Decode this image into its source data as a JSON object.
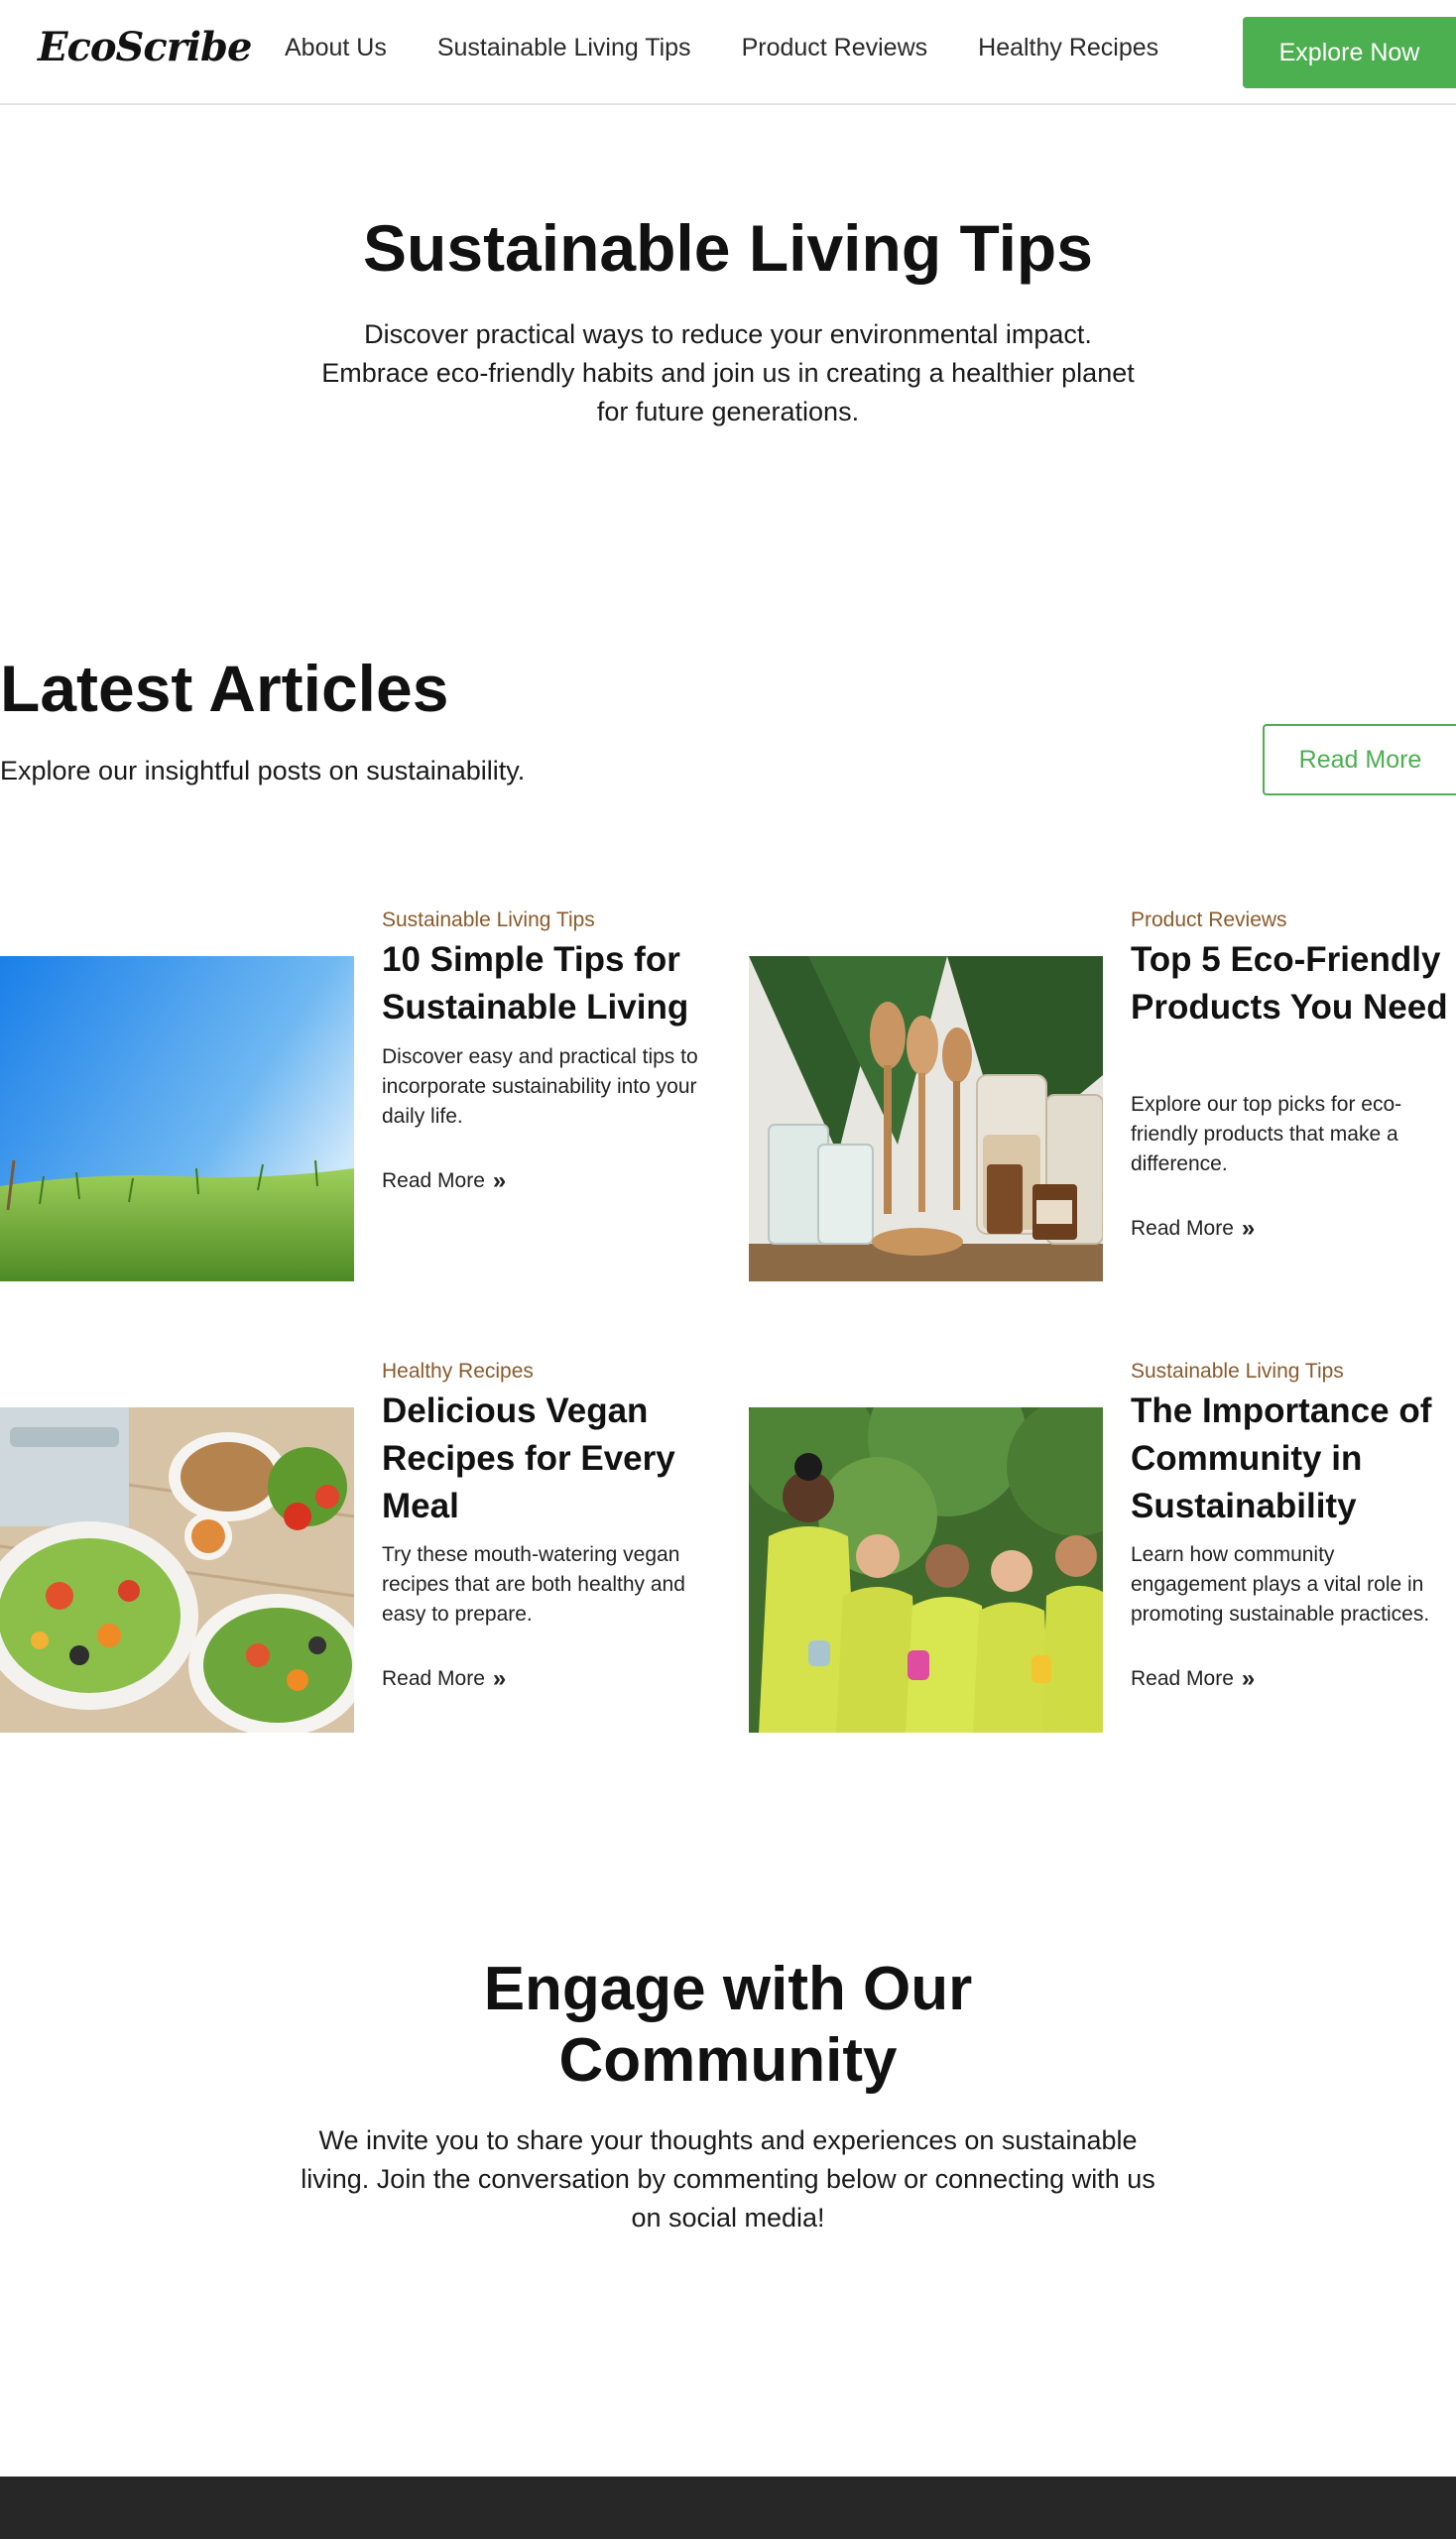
{
  "nav": {
    "logo": "EcoScribe",
    "links": [
      "About Us",
      "Sustainable Living Tips",
      "Product Reviews",
      "Healthy Recipes"
    ],
    "cta": "Explore Now"
  },
  "hero": {
    "title": "Sustainable Living Tips",
    "text": "Discover practical ways to reduce your environmental impact. Embrace eco-friendly habits and join us in creating a healthier planet for future generations."
  },
  "latest": {
    "title": "Latest Articles",
    "subtitle": "Explore our insightful posts on sustainability.",
    "button": "Read More"
  },
  "articles": [
    {
      "category": "Sustainable Living Tips",
      "title": "10 Simple Tips for Sustainable Living",
      "desc": "Discover easy and practical tips to incorporate sustainability into your daily life.",
      "link": "Read More",
      "image": "grass-field-blue-sky-photo"
    },
    {
      "category": "Product Reviews",
      "title": "Top 5 Eco-Friendly Products You Need",
      "desc": "Explore our top picks for eco-friendly products that make a difference.",
      "link": "Read More",
      "image": "wooden-utensils-glass-jars-photo"
    },
    {
      "category": "Healthy Recipes",
      "title": "Delicious Vegan Recipes for Every Meal",
      "desc": "Try these mouth-watering vegan recipes that are both healthy and easy to prepare.",
      "link": "Read More",
      "image": "vegan-salad-plates-photo"
    },
    {
      "category": "Sustainable Living Tips",
      "title": "The Importance of Community in Sustainability",
      "desc": "Learn how community engagement plays a vital role in promoting sustainable practices.",
      "link": "Read More",
      "image": "community-cleanup-volunteers-photo"
    }
  ],
  "community": {
    "title": "Engage with Our Community",
    "text": "We invite you to share your thoughts and experiences on sustainable living. Join the conversation by commenting below or connecting with us on social media!"
  },
  "icons": {
    "read_more": "double-chevron-right-icon"
  },
  "colors": {
    "accent": "#4caf50",
    "category": "#8a5a2b",
    "footer": "#272727"
  }
}
